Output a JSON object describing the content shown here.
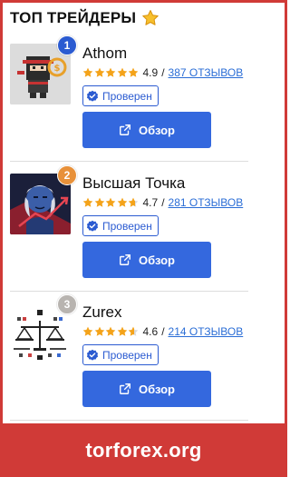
{
  "header": {
    "title": "ТОП ТРЕЙДЕРЫ",
    "icon": "star-icon"
  },
  "colors": {
    "brand_red": "#d03a37",
    "button_blue": "#3468de",
    "link_blue": "#2a6dd6",
    "star_orange": "#f4a31a",
    "rank_gold": "#2b5bd1",
    "rank_silver": "#e8913a",
    "rank_bronze": "#b8b4b0"
  },
  "traders": [
    {
      "rank": "1",
      "rank_color": "#2b5bd1",
      "name": "Athom",
      "score": "4.9",
      "stars_filled": 5,
      "reviews": "387 ОТЗЫВОВ",
      "verified": "Проверен",
      "button": "Обзор",
      "avatar_icon": "ninja-avatar-icon"
    },
    {
      "rank": "2",
      "rank_color": "#e8913a",
      "name": "Высшая Точка",
      "score": "4.7",
      "stars_filled": 4.7,
      "reviews": "281 ОТЗЫВОВ",
      "verified": "Проверен",
      "button": "Обзор",
      "avatar_icon": "franklin-avatar-icon"
    },
    {
      "rank": "3",
      "rank_color": "#b8b4b0",
      "name": "Zurex",
      "score": "4.6",
      "stars_filled": 4.6,
      "reviews": "214 ОТЗЫВОВ",
      "verified": "Проверен",
      "button": "Обзор",
      "avatar_icon": "scales-avatar-icon"
    }
  ],
  "footer": {
    "text": "torforex.org"
  }
}
